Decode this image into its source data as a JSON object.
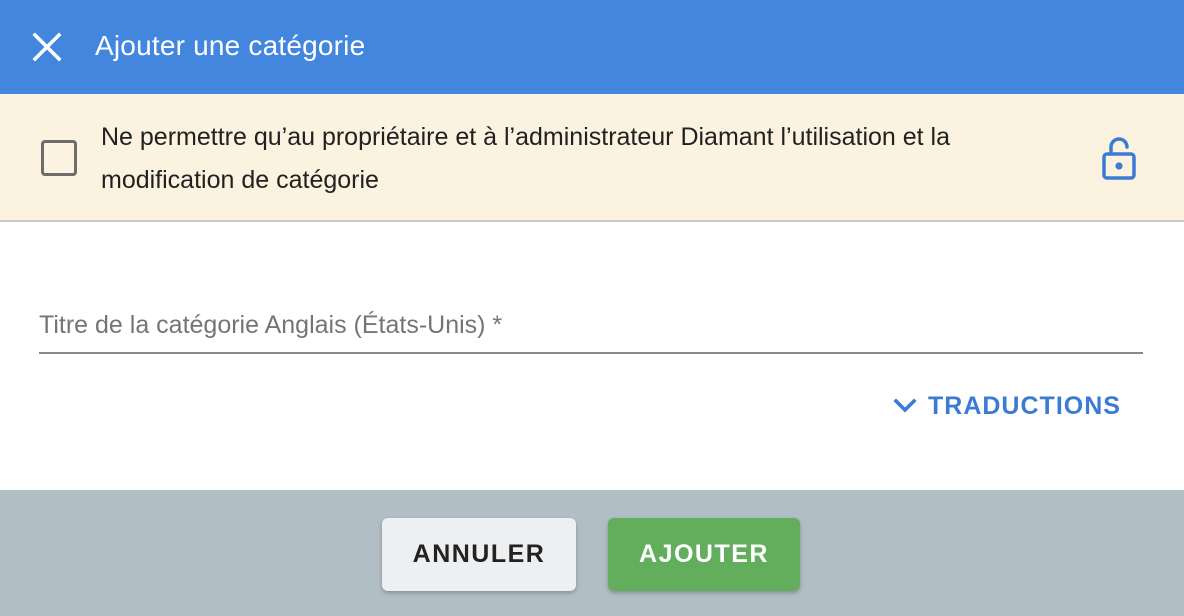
{
  "header": {
    "title": "Ajouter une catégorie",
    "close_icon": "close-icon"
  },
  "banner": {
    "text": "Ne permettre qu’au propriétaire et à l’administrateur Diamant l’utilisation et la modification de catégorie",
    "checked": false,
    "lock_icon": "lock-open-icon"
  },
  "form": {
    "title_field": {
      "placeholder": "Titre de la catégorie Anglais (États-Unis) *",
      "value": ""
    },
    "translations_label": "TRADUCTIONS",
    "translations_icon": "chevron-down-icon"
  },
  "footer": {
    "cancel_label": "ANNULER",
    "add_label": "AJOUTER"
  },
  "colors": {
    "header_bg": "#4286DE",
    "banner_bg": "#FCF2E0",
    "accent": "#3B7BD4",
    "footer_bg": "#B2BEC5",
    "add_button": "#63AE5C",
    "cancel_button": "#EDEFF1"
  }
}
